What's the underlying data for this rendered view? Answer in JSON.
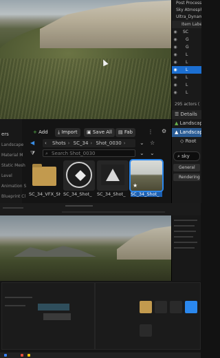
{
  "outliner": {
    "menu_lines": [
      "Post Process",
      "Sky Atmosph",
      "Ultra_Dynami"
    ],
    "header": "Item Label",
    "rows": [
      "SC",
      "G",
      "G",
      "L",
      "L",
      "L",
      "L",
      "L",
      "L"
    ],
    "actor_count": "295 actors ("
  },
  "details": {
    "tab": "Details",
    "actor_label": "Landscap",
    "selected_label": "Landscap",
    "root_label": "Root",
    "search_value": "sky",
    "categories": [
      "General",
      "Rendering"
    ]
  },
  "content_browser": {
    "sidebar_head": "ers",
    "sidebar_items": [
      "Landscape",
      "Material M",
      "Static Mesh",
      "Level",
      "Animation S",
      "Blueprint Cl"
    ],
    "toolbar": {
      "add_label": "Add",
      "import_label": "Import",
      "save_all_label": "Save All",
      "fab_label": "Fab"
    },
    "breadcrumbs": [
      "Shots",
      "SC_34",
      "Shot_0030"
    ],
    "search_placeholder": "Search Shot_0030",
    "assets": [
      {
        "name": "SC_34_VFX_SH",
        "kind": "folder"
      },
      {
        "name": "SC_34_Shot_",
        "kind": "level"
      },
      {
        "name": "SC_34_Shot_",
        "kind": "mount"
      },
      {
        "name": "SC_34_Shot_",
        "kind": "landscape"
      }
    ]
  },
  "colors": {
    "selection_blue": "#1c6fd1",
    "tile_highlight": "#2b88ee",
    "folder": "#c29a4e"
  }
}
